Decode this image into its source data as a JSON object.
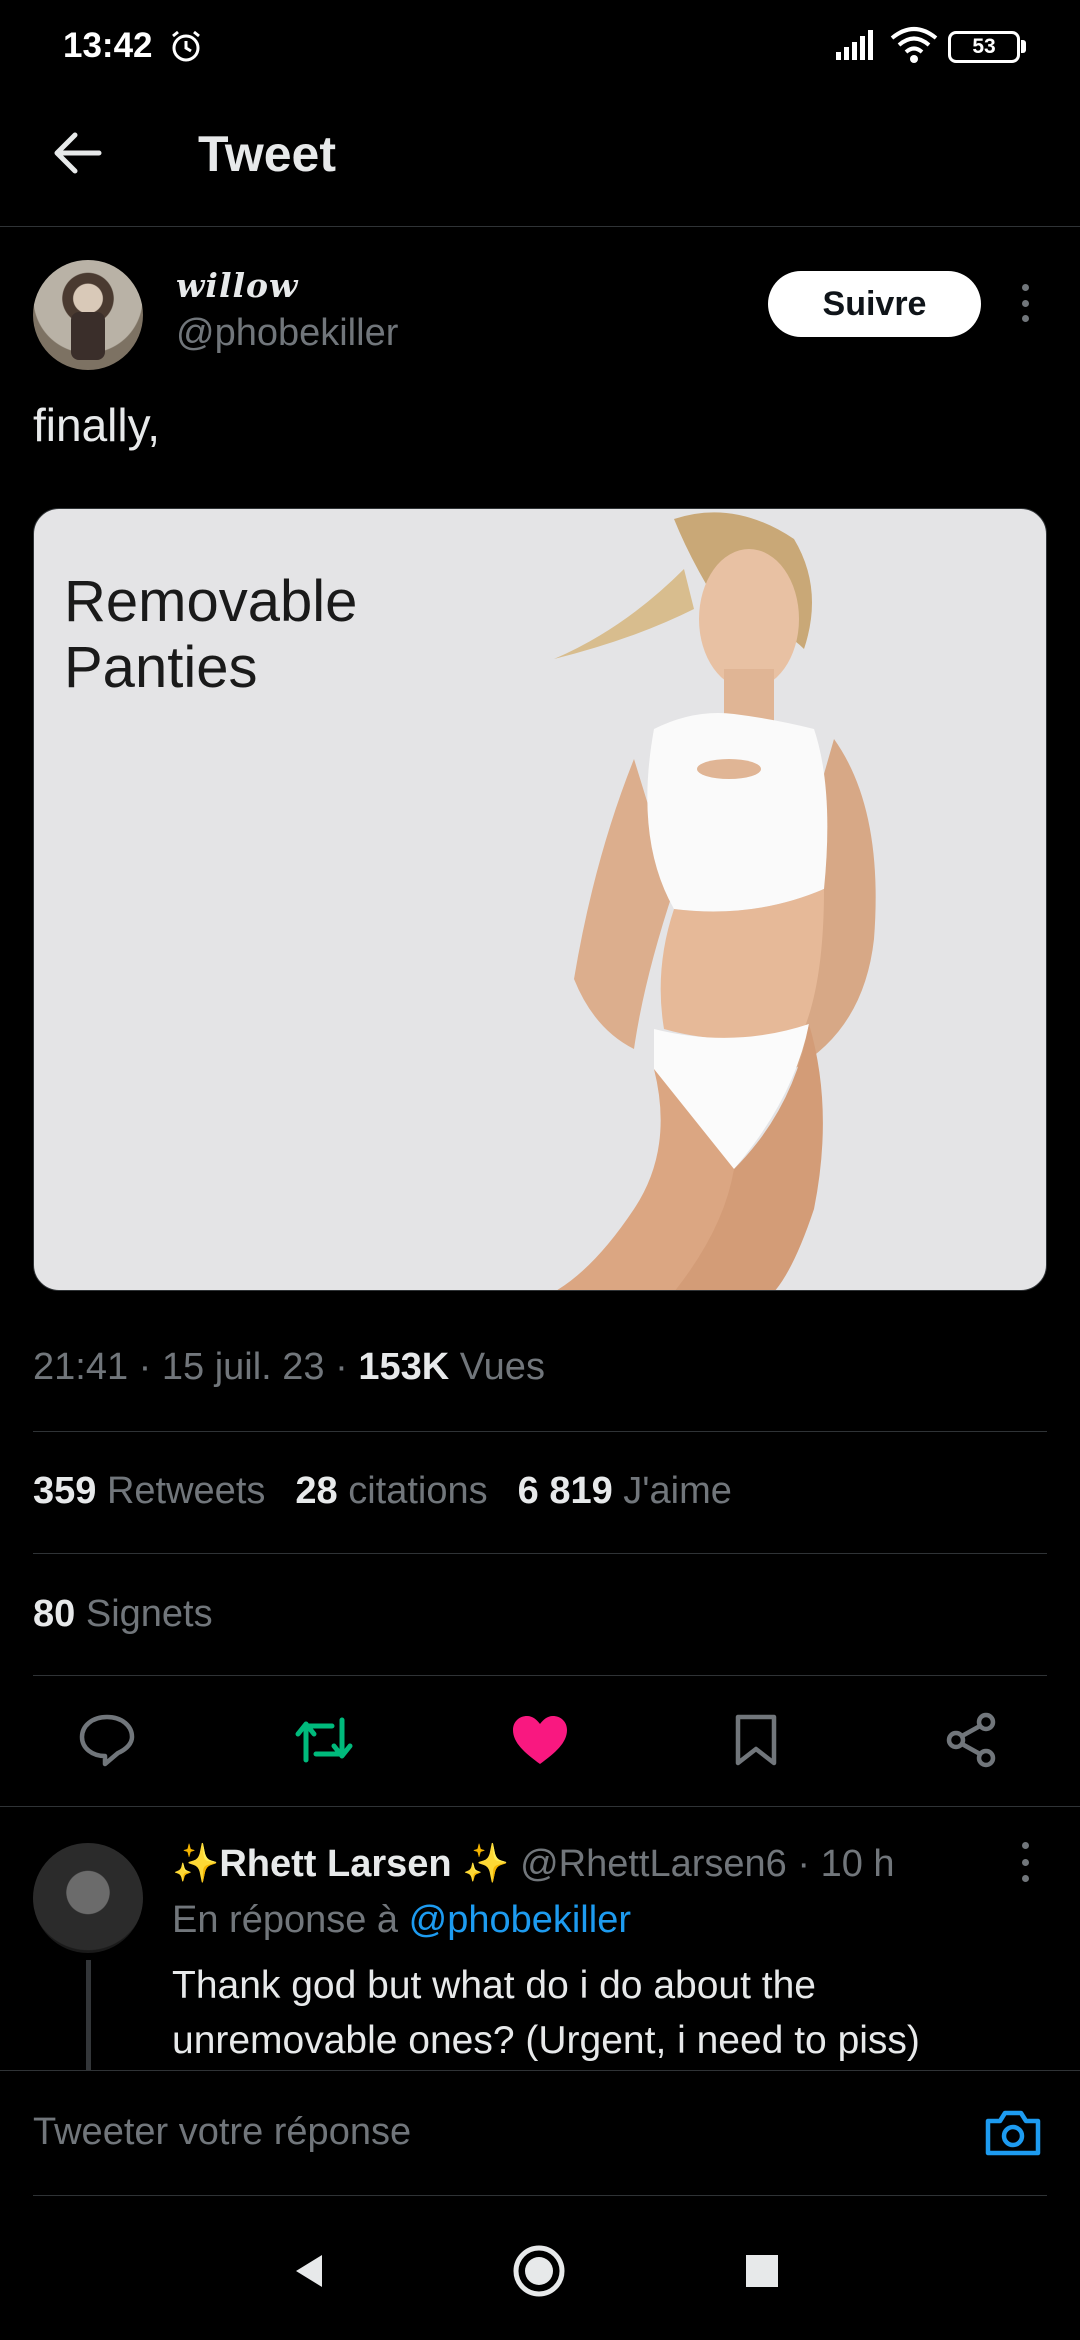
{
  "status_bar": {
    "time": "13:42",
    "battery": "53"
  },
  "header": {
    "title": "Tweet"
  },
  "author": {
    "display_name": "willow",
    "handle": "@phobekiller",
    "follow_label": "Suivre"
  },
  "tweet": {
    "text": "finally,",
    "media_caption_line1": "Removable",
    "media_caption_line2": "Panties",
    "time": "21:41",
    "date": "15 juil. 23",
    "views_count": "153K",
    "views_label": "Vues",
    "retweets_count": "359",
    "retweets_label": "Retweets",
    "quotes_count": "28",
    "quotes_label": "citations",
    "likes_count": "6 819",
    "likes_label": "J'aime",
    "bookmarks_count": "80",
    "bookmarks_label": "Signets"
  },
  "actions": {
    "icons": [
      "reply-icon",
      "retweet-icon",
      "like-icon",
      "bookmark-icon",
      "share-icon"
    ],
    "retweet_color": "#00ba7c",
    "like_color": "#f91880"
  },
  "reply": {
    "name": "Rhett Larsen",
    "handle": "@RhettLarsen6",
    "age": "10 h",
    "in_reply_prefix": "En réponse à",
    "in_reply_mention": "@phobekiller",
    "text": "Thank god but what do i do about the unremovable ones? (Urgent, i need to piss)"
  },
  "compose": {
    "placeholder": "Tweeter votre réponse"
  },
  "colors": {
    "accent": "#1d9bf0",
    "background": "#000000",
    "muted": "#71767b"
  }
}
